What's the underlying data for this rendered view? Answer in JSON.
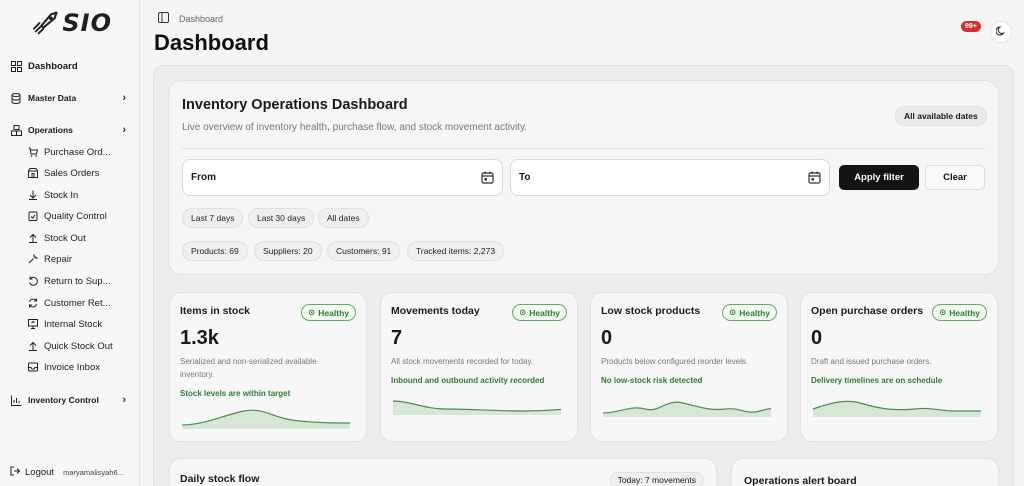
{
  "sidebar": {
    "logo_text": "SIO",
    "items": [
      {
        "label": "Dashboard",
        "icon": "grid-icon"
      },
      {
        "label": "Master Data",
        "icon": "database-icon"
      },
      {
        "label": "Operations",
        "icon": "boxes-icon"
      },
      {
        "label": "Inventory Control",
        "icon": "bar-chart-icon"
      }
    ],
    "operations_sub": [
      {
        "label": "Purchase Ord...",
        "icon": "cart-icon"
      },
      {
        "label": "Sales Orders",
        "icon": "store-icon"
      },
      {
        "label": "Stock In",
        "icon": "arrow-down-icon"
      },
      {
        "label": "Quality Control",
        "icon": "clipboard-check-icon"
      },
      {
        "label": "Stock Out",
        "icon": "arrow-up-icon"
      },
      {
        "label": "Repair",
        "icon": "wrench-icon"
      },
      {
        "label": "Return to Sup...",
        "icon": "undo-icon"
      },
      {
        "label": "Customer Ret...",
        "icon": "refresh-icon"
      },
      {
        "label": "Internal Stock",
        "icon": "monitor-icon"
      },
      {
        "label": "Quick Stock Out",
        "icon": "arrow-up-icon"
      },
      {
        "label": "Invoice Inbox",
        "icon": "inbox-icon"
      }
    ],
    "logout_label": "Logout",
    "user": "maryamalisyah6..."
  },
  "header": {
    "breadcrumb": "Dashboard",
    "title": "Dashboard",
    "notification_count": "99+"
  },
  "hero": {
    "title": "Inventory Operations Dashboard",
    "subtitle": "Live overview of inventory health, purchase flow, and stock movement activity.",
    "date_range_pill": "All available dates",
    "from_label": "From",
    "to_label": "To",
    "apply_label": "Apply filter",
    "clear_label": "Clear",
    "presets": [
      "Last 7 days",
      "Last 30 days",
      "All dates"
    ],
    "counts": [
      "Products: 69",
      "Suppliers: 20",
      "Customers: 91",
      "Tracked items: 2,273"
    ]
  },
  "cards": [
    {
      "title": "Items in stock",
      "badge": "Healthy",
      "value": "1.3k",
      "desc": "Serialized and non-serialized available inventory.",
      "status": "Stock levels are within target"
    },
    {
      "title": "Movements today",
      "badge": "Healthy",
      "value": "7",
      "desc": "All stock movements recorded for today.",
      "status": "Inbound and outbound activity recorded"
    },
    {
      "title": "Low stock products",
      "badge": "Healthy",
      "value": "0",
      "desc": "Products below configured reorder levels.",
      "status": "No low-stock risk detected"
    },
    {
      "title": "Open purchase orders",
      "badge": "Healthy",
      "value": "0",
      "desc": "Draft and issued purchase orders.",
      "status": "Delivery timelines are on schedule"
    }
  ],
  "bottom": {
    "flow_title": "Daily stock flow",
    "flow_pill": "Today: 7 movements",
    "alert_title": "Operations alert board"
  },
  "colors": {
    "healthy": "#2e7d32",
    "spark_fill": "#d7e7d5",
    "spark_line": "#4f8a52"
  }
}
